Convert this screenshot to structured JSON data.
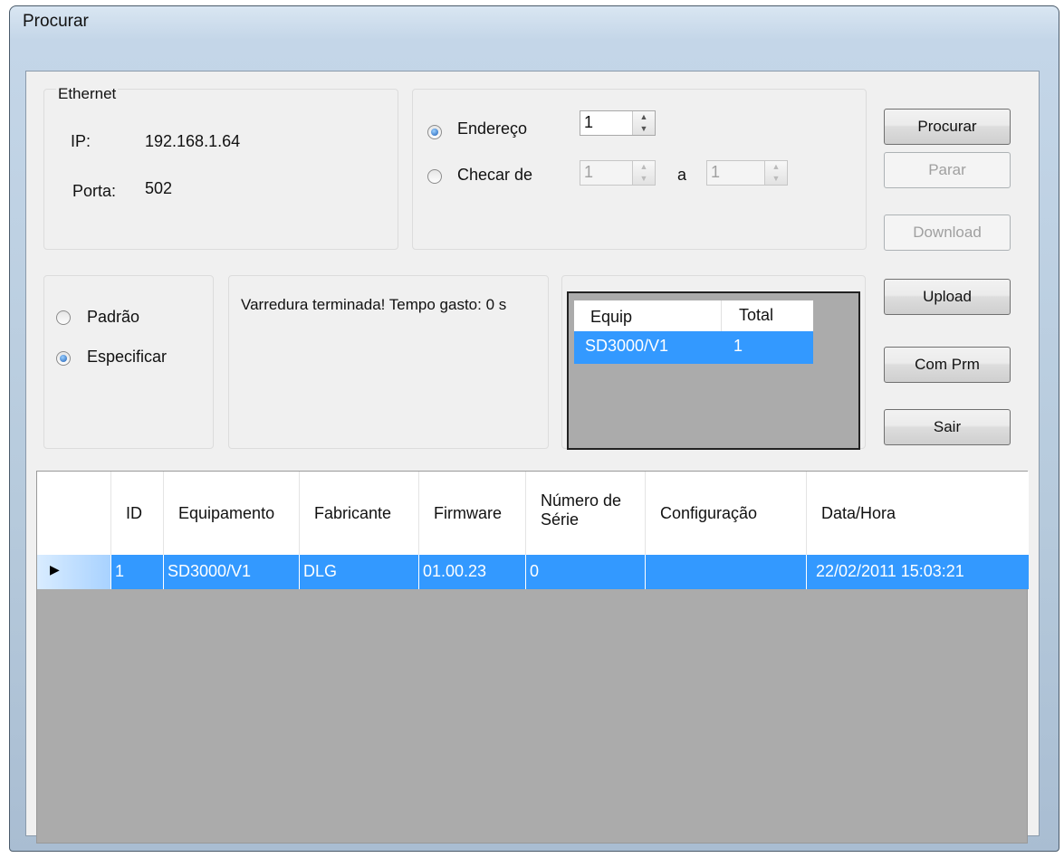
{
  "window": {
    "title": "Procurar"
  },
  "ethernet": {
    "legend": "Ethernet",
    "ip_label": "IP:",
    "ip_value": "192.168.1.64",
    "porta_label": "Porta:",
    "porta_value": "502"
  },
  "address": {
    "endereco_label": "Endereço",
    "endereco_value": "1",
    "checar_label": "Checar de",
    "from_value": "1",
    "a_label": "a",
    "to_value": "1",
    "selected": "endereco"
  },
  "mode": {
    "padrao_label": "Padrão",
    "especificar_label": "Especificar",
    "selected": "especificar"
  },
  "status": {
    "message": "Varredura terminada! Tempo gasto: 0 s"
  },
  "summary_grid": {
    "headers": [
      "Equip",
      "Total"
    ],
    "rows": [
      [
        "SD3000/V1",
        "1"
      ]
    ]
  },
  "buttons": {
    "procurar": "Procurar",
    "parar": "Parar",
    "download": "Download",
    "upload": "Upload",
    "com_prm": "Com Prm",
    "sair": "Sair"
  },
  "device_grid": {
    "headers": [
      "ID",
      "Equipamento",
      "Fabricante",
      "Firmware",
      "Número de Série",
      "Configuração",
      "Data/Hora"
    ],
    "rows": [
      [
        "1",
        "SD3000/V1",
        "DLG",
        "01.00.23",
        "0",
        "",
        "22/02/2011 15:03:21"
      ]
    ]
  },
  "colors": {
    "selection": "#3399ff",
    "grid_bg": "#ababab",
    "client_bg": "#f0f0f0"
  }
}
